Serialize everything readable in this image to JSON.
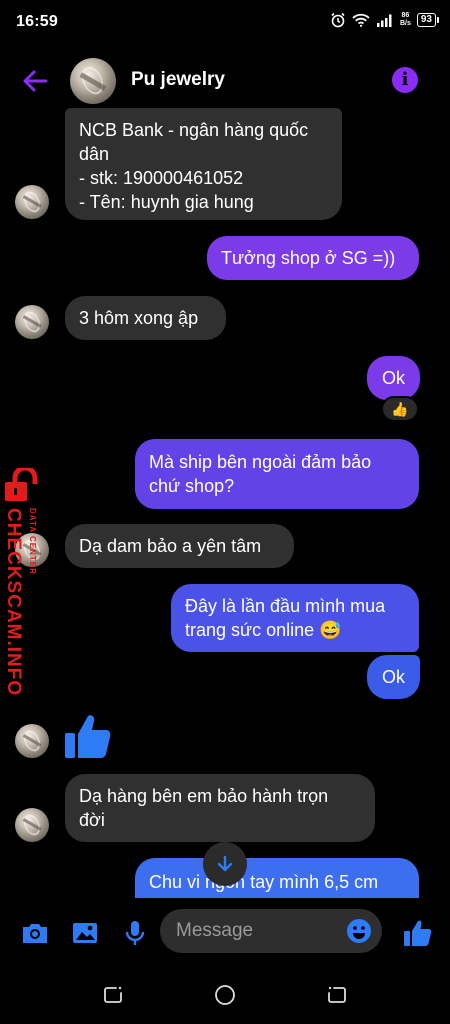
{
  "status_bar": {
    "time": "16:59",
    "net_speed_value": "86",
    "net_speed_unit": "B/s",
    "battery": "93"
  },
  "header": {
    "title": "Pu jewelry"
  },
  "messages": [
    {
      "from": "them",
      "lines": [
        "NCB Bank - ngân hàng quốc",
        "dân",
        "- stk: 190000461052",
        "- Tên: huynh gia hung"
      ]
    },
    {
      "from": "me",
      "text": "Tưởng shop ở SG =))"
    },
    {
      "from": "them",
      "text": "3 hôm xong ập"
    },
    {
      "from": "me",
      "text": "Ok",
      "reaction": "👍"
    },
    {
      "from": "me",
      "lines": [
        "Mà ship bên ngoài đảm bảo",
        "chứ shop?"
      ]
    },
    {
      "from": "them",
      "text": "Dạ dam bảo a yên tâm"
    },
    {
      "from": "me",
      "lines": [
        "Đây là lần đầu mình mua",
        "trang sức online 😅"
      ]
    },
    {
      "from": "me",
      "text": "Ok"
    },
    {
      "from": "them",
      "type": "like"
    },
    {
      "from": "them",
      "lines": [
        "Dạ hàng bên em bảo hành trọn",
        "đời"
      ]
    },
    {
      "from": "me",
      "text": "Chu vi ngón tay mình 6,5 cm"
    }
  ],
  "watermark": {
    "main": "CHECKSCAM.INFO",
    "sub": "DATA CENTER"
  },
  "composer": {
    "placeholder": "Message"
  },
  "colors": {
    "accent": "#8b2cf5",
    "sent_purple": "#7b3be8",
    "sent_blue": "#3b5ce8",
    "received": "#303030",
    "icon_blue": "#2f7bf5",
    "watermark": "#e21c1c"
  }
}
